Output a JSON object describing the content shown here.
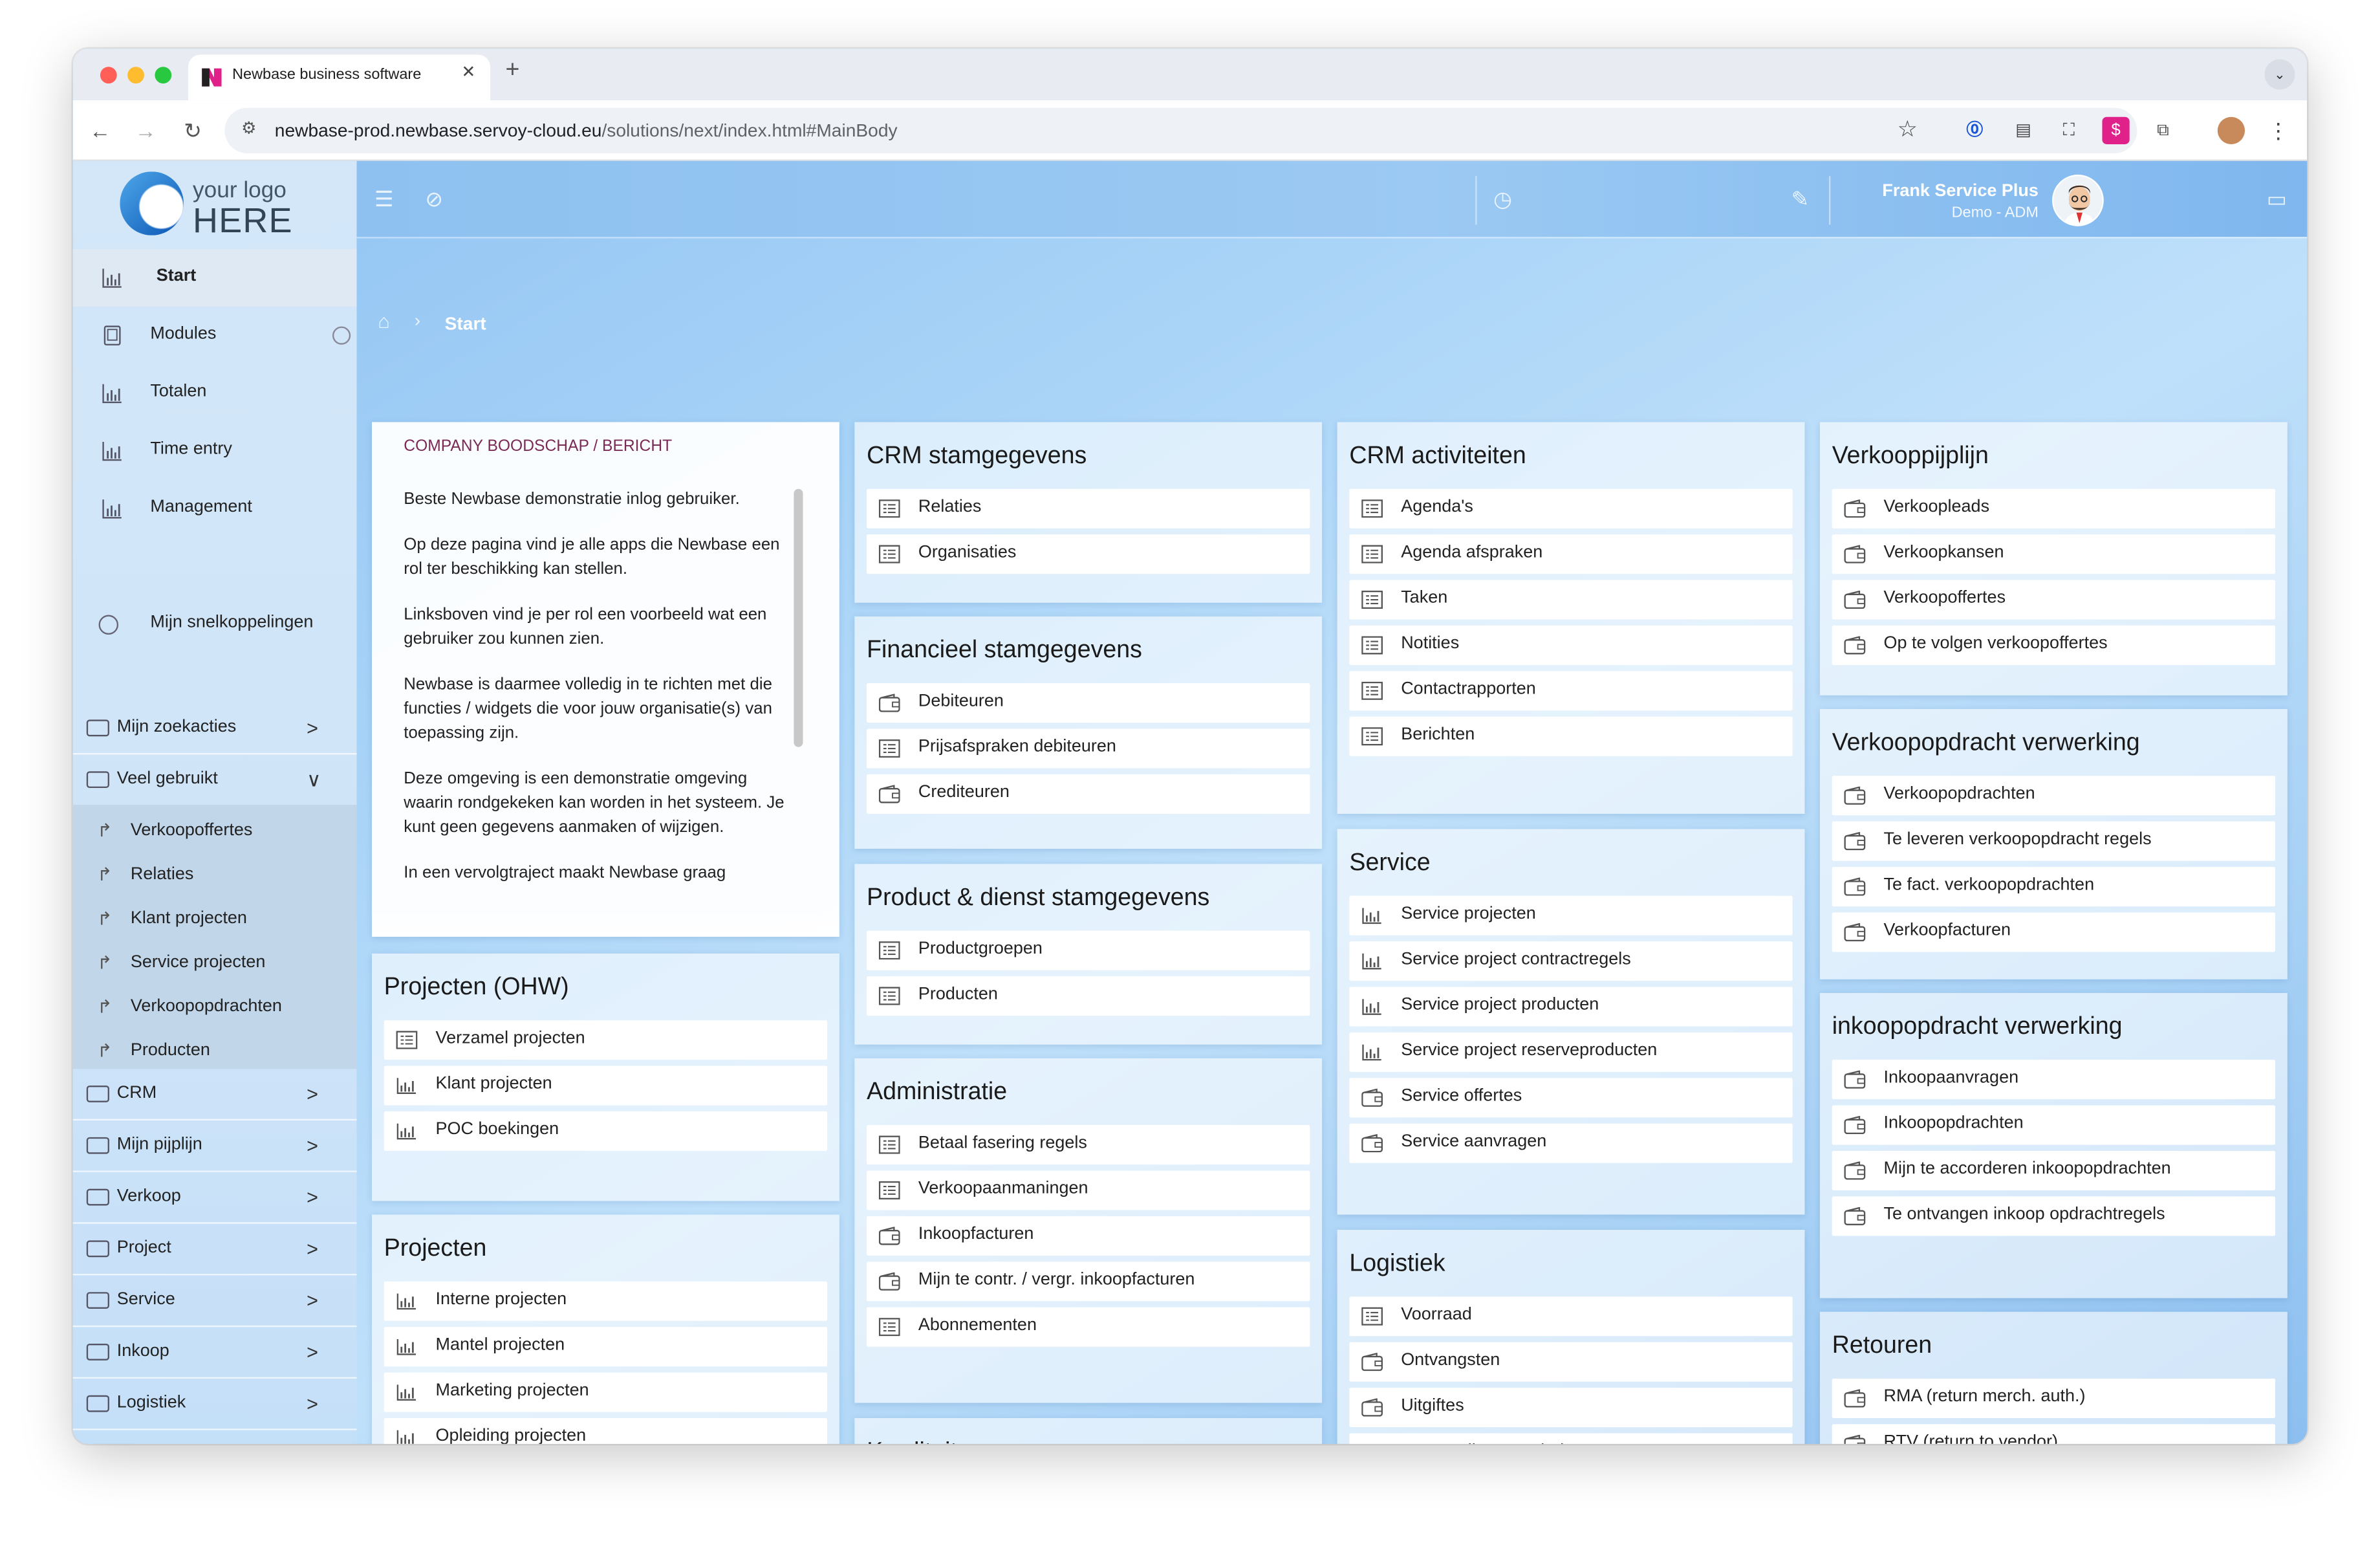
{
  "browser": {
    "tab_title": "Newbase business software",
    "url_host": "newbase-prod.newbase.servoy-cloud.eu",
    "url_path": "/solutions/next/index.html#MainBody"
  },
  "logo": {
    "line1": "your logo",
    "line2": "HERE"
  },
  "user": {
    "name": "Frank Service Plus",
    "role": "Demo - ADM"
  },
  "breadcrumb": {
    "current": "Start"
  },
  "sidebar": {
    "nav": [
      {
        "label": "Start"
      },
      {
        "label": "Modules"
      },
      {
        "label": "Totalen"
      },
      {
        "label": "Time entry"
      },
      {
        "label": "Management"
      }
    ],
    "shortcuts_label": "Mijn snelkoppelingen",
    "folders_top": [
      {
        "label": "Mijn zoekacties",
        "chevron": ">"
      },
      {
        "label": "Veel gebruikt",
        "chevron": "∨"
      }
    ],
    "veel_gebruikt": [
      {
        "label": "Verkoopoffertes"
      },
      {
        "label": "Relaties"
      },
      {
        "label": "Klant projecten"
      },
      {
        "label": "Service projecten"
      },
      {
        "label": "Verkoopopdrachten"
      },
      {
        "label": "Producten"
      }
    ],
    "folders_bottom": [
      {
        "label": "CRM",
        "chevron": ">"
      },
      {
        "label": "Mijn pijplijn",
        "chevron": ">"
      },
      {
        "label": "Verkoop",
        "chevron": ">"
      },
      {
        "label": "Project",
        "chevron": ">"
      },
      {
        "label": "Service",
        "chevron": ">"
      },
      {
        "label": "Inkoop",
        "chevron": ">"
      },
      {
        "label": "Logistiek",
        "chevron": ">"
      }
    ]
  },
  "message": {
    "title": "COMPANY BOODSCHAP / BERICHT",
    "paragraphs": [
      "Beste Newbase demonstratie inlog gebruiker.",
      "Op deze pagina vind je alle apps die Newbase een rol ter beschikking kan stellen.",
      "Linksboven vind je per rol een voorbeeld wat een gebruiker zou kunnen zien.",
      "Newbase is daarmee volledig in te richten met die functies / widgets die voor jouw organisatie(s) van toepassing zijn.",
      "Deze omgeving is een demonstratie omgeving waarin rondgekeken kan worden in het systeem. Je kunt geen gegevens aanmaken of wijzigen.",
      "In een vervolgtraject maakt Newbase graag"
    ]
  },
  "cards": {
    "projecten_ohw": {
      "title": "Projecten (OHW)",
      "items": [
        {
          "label": "Verzamel projecten",
          "icon": "list-icon"
        },
        {
          "label": "Klant projecten",
          "icon": "chart-icon"
        },
        {
          "label": "POC boekingen",
          "icon": "chart-icon"
        }
      ]
    },
    "projecten": {
      "title": "Projecten",
      "items": [
        {
          "label": "Interne projecten",
          "icon": "chart-icon"
        },
        {
          "label": "Mantel projecten",
          "icon": "chart-icon"
        },
        {
          "label": "Marketing projecten",
          "icon": "chart-icon"
        },
        {
          "label": "Opleiding projecten",
          "icon": "chart-icon"
        }
      ]
    },
    "crm_stam": {
      "title": "CRM stamgegevens",
      "items": [
        {
          "label": "Relaties",
          "icon": "list-icon"
        },
        {
          "label": "Organisaties",
          "icon": "list-icon"
        }
      ]
    },
    "fin_stam": {
      "title": "Financieel stamgegevens",
      "items": [
        {
          "label": "Debiteuren",
          "icon": "wallet-icon"
        },
        {
          "label": "Prijsafspraken debiteuren",
          "icon": "list-icon"
        },
        {
          "label": "Crediteuren",
          "icon": "wallet-icon"
        }
      ]
    },
    "product_stam": {
      "title": "Product & dienst stamgegevens",
      "items": [
        {
          "label": "Productgroepen",
          "icon": "list-icon"
        },
        {
          "label": "Producten",
          "icon": "list-icon"
        }
      ]
    },
    "administratie": {
      "title": "Administratie",
      "items": [
        {
          "label": "Betaal fasering regels",
          "icon": "list-icon"
        },
        {
          "label": "Verkoopaanmaningen",
          "icon": "list-icon"
        },
        {
          "label": "Inkoopfacturen",
          "icon": "wallet-icon"
        },
        {
          "label": "Mijn te contr. / vergr. inkoopfacturen",
          "icon": "wallet-icon"
        },
        {
          "label": "Abonnementen",
          "icon": "list-icon"
        }
      ]
    },
    "kwaliteit": {
      "title": "Kwaliteit",
      "items": []
    },
    "crm_act": {
      "title": "CRM activiteiten",
      "items": [
        {
          "label": "Agenda's",
          "icon": "list-icon"
        },
        {
          "label": "Agenda afspraken",
          "icon": "list-icon"
        },
        {
          "label": "Taken",
          "icon": "list-icon"
        },
        {
          "label": "Notities",
          "icon": "list-icon"
        },
        {
          "label": "Contactrapporten",
          "icon": "list-icon"
        },
        {
          "label": "Berichten",
          "icon": "list-icon"
        }
      ]
    },
    "service": {
      "title": "Service",
      "items": [
        {
          "label": "Service projecten",
          "icon": "chart-icon"
        },
        {
          "label": "Service project contractregels",
          "icon": "chart-icon"
        },
        {
          "label": "Service project producten",
          "icon": "chart-icon"
        },
        {
          "label": "Service project reserveproducten",
          "icon": "chart-icon"
        },
        {
          "label": "Service offertes",
          "icon": "wallet-icon"
        },
        {
          "label": "Service aanvragen",
          "icon": "wallet-icon"
        }
      ]
    },
    "logistiek": {
      "title": "Logistiek",
      "items": [
        {
          "label": "Voorraad",
          "icon": "list-icon"
        },
        {
          "label": "Ontvangsten",
          "icon": "wallet-icon"
        },
        {
          "label": "Uitgiftes",
          "icon": "wallet-icon"
        },
        {
          "label": "Voorraadherwaardering",
          "icon": "list-icon"
        }
      ]
    },
    "verkooppijplijn": {
      "title": "Verkooppijplijn",
      "items": [
        {
          "label": "Verkoopleads",
          "icon": "wallet-icon"
        },
        {
          "label": "Verkoopkansen",
          "icon": "wallet-icon"
        },
        {
          "label": "Verkoopoffertes",
          "icon": "wallet-icon"
        },
        {
          "label": "Op te volgen verkoopoffertes",
          "icon": "wallet-icon"
        }
      ]
    },
    "verkoopopdracht": {
      "title": "Verkoopopdracht verwerking",
      "items": [
        {
          "label": "Verkoopopdrachten",
          "icon": "wallet-icon"
        },
        {
          "label": "Te leveren verkoopopdracht regels",
          "icon": "wallet-icon"
        },
        {
          "label": "Te fact. verkoopopdrachten",
          "icon": "wallet-icon"
        },
        {
          "label": "Verkoopfacturen",
          "icon": "wallet-icon"
        }
      ]
    },
    "inkoop": {
      "title": "inkoopopdracht verwerking",
      "items": [
        {
          "label": "Inkoopaanvragen",
          "icon": "wallet-icon"
        },
        {
          "label": "Inkoopopdrachten",
          "icon": "wallet-icon"
        },
        {
          "label": "Mijn te accorderen inkoopopdrachten",
          "icon": "wallet-icon"
        },
        {
          "label": "Te ontvangen inkoop opdrachtregels",
          "icon": "wallet-icon"
        }
      ]
    },
    "retouren": {
      "title": "Retouren",
      "items": [
        {
          "label": "RMA (return merch. auth.)",
          "icon": "wallet-icon"
        },
        {
          "label": "RTV (return to vendor)",
          "icon": "wallet-icon"
        }
      ]
    }
  }
}
